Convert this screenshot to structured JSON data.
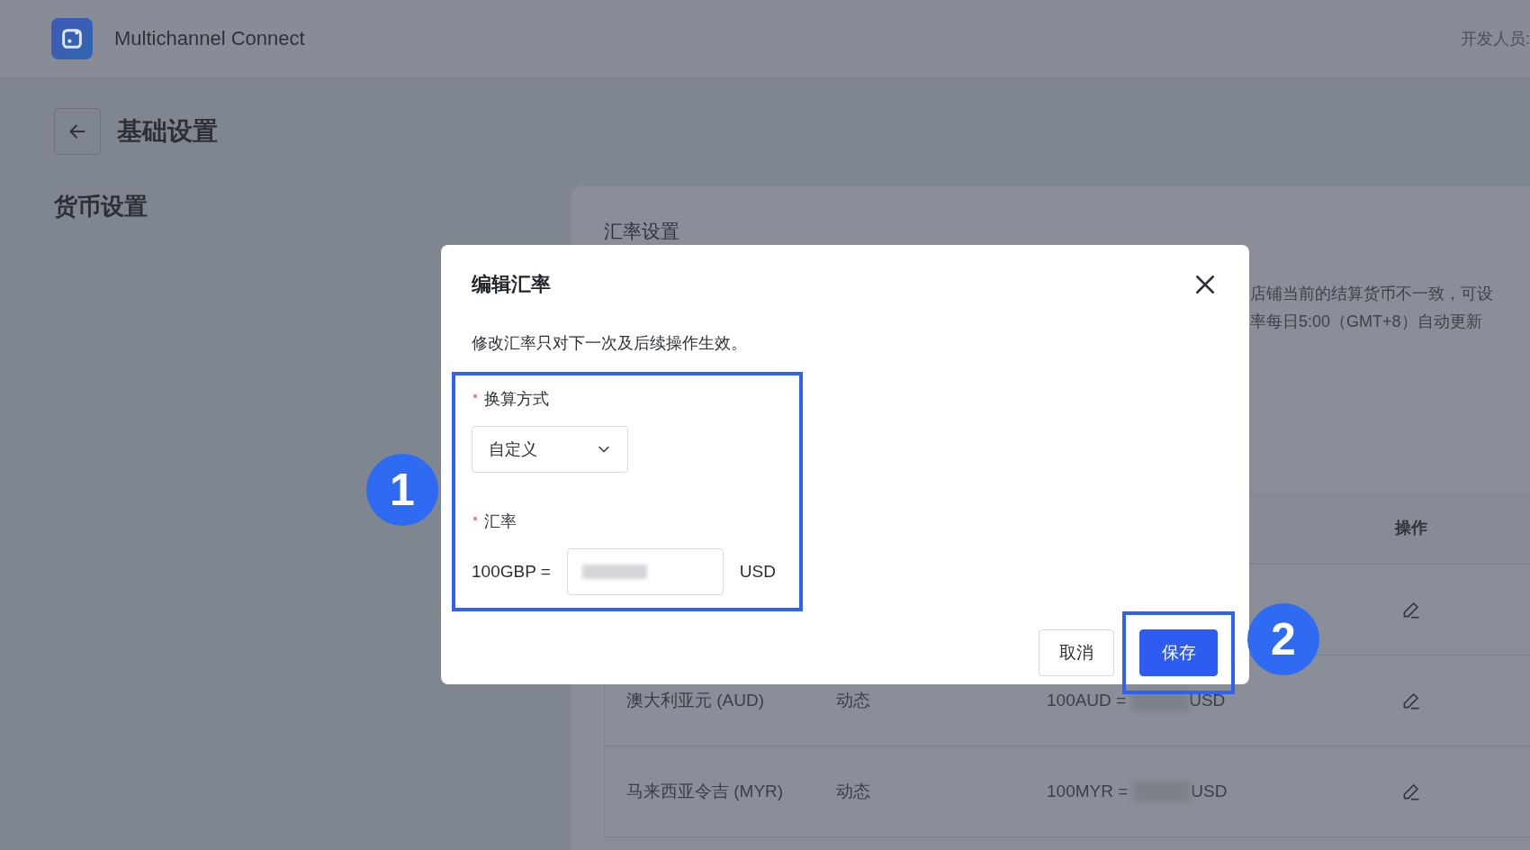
{
  "header": {
    "app_name": "Multichannel Connect",
    "developer_label": "开发人员:"
  },
  "page": {
    "title": "基础设置",
    "section_title": "货币设置"
  },
  "rate_card": {
    "title": "汇率设置",
    "description_lines": [
      "店铺当前的结算货币不一致，可设",
      "率每日5:00（GMT+8）自动更新"
    ],
    "action_column_label": "操作",
    "rows": [
      {
        "kind": "covered"
      },
      {
        "kind": "full",
        "currency": "澳大利亚元 (AUD)",
        "mode": "动态",
        "rate_prefix": "100AUD =",
        "rate_suffix": "USD"
      },
      {
        "kind": "full",
        "currency": "马来西亚令吉 (MYR)",
        "mode": "动态",
        "rate_prefix": "100MYR =",
        "rate_suffix": "USD"
      }
    ]
  },
  "dialog": {
    "title": "编辑汇率",
    "note": "修改汇率只对下一次及后续操作生效。",
    "form_highlighted": true,
    "fields": [
      {
        "kind": "select",
        "label": "换算方式",
        "required": true,
        "value": "自定义"
      },
      {
        "kind": "rate",
        "label": "汇率",
        "required": true,
        "prefix": "100GBP =",
        "suffix": "USD"
      }
    ],
    "buttons": [
      {
        "label": "取消",
        "kind": "secondary",
        "highlighted": false
      },
      {
        "label": "保存",
        "kind": "primary",
        "highlighted": true
      }
    ]
  },
  "annotations": [
    {
      "number": "1"
    },
    {
      "number": "2"
    }
  ]
}
